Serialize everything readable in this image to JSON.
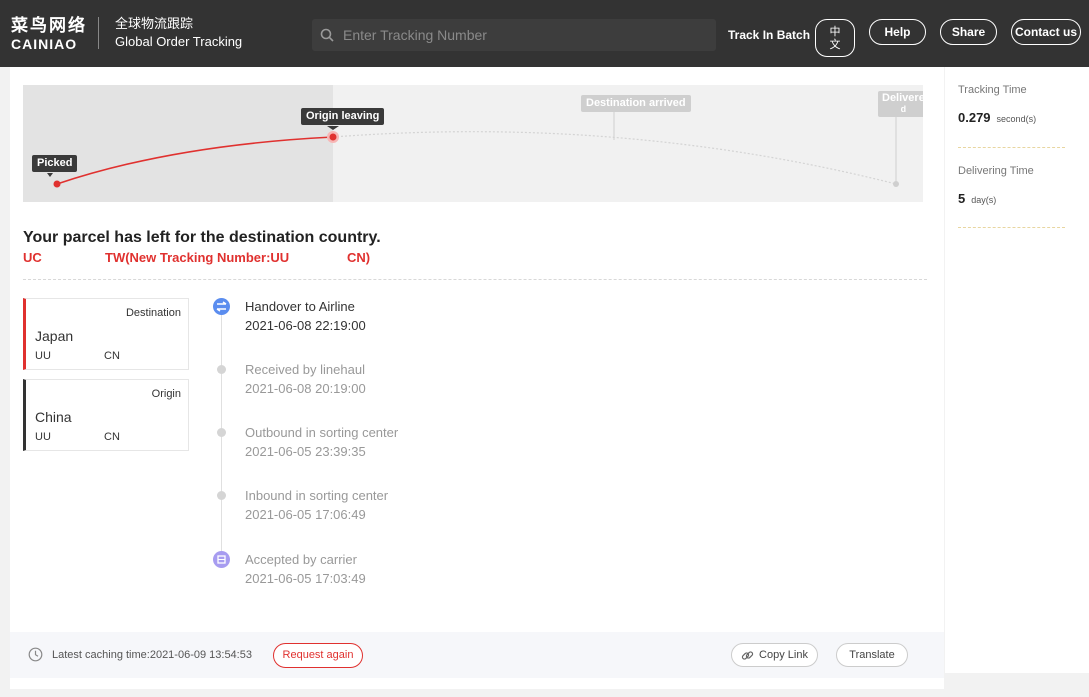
{
  "header": {
    "logo_cn": "菜鸟网络",
    "logo_en": "CAINIAO",
    "title_cn": "全球物流跟踪",
    "title_en": "Global Order Tracking",
    "search_placeholder": "Enter Tracking Number",
    "batch_label": "Track In Batch",
    "lang_line1": "中",
    "lang_line2": "文",
    "help_label": "Help",
    "share_label": "Share",
    "contact_label": "Contact us"
  },
  "map": {
    "stages": [
      "Picked",
      "Origin leaving",
      "Destination arrived",
      "Delivered"
    ],
    "delivered_visible": "Delivere",
    "delivered_wrap": "d",
    "progress_color": "#e0312f"
  },
  "status": {
    "headline": "Your parcel has left for the destination country.",
    "tracking_part1": "UC",
    "tracking_part2": "TW(New Tracking Number:UU",
    "tracking_part3": "CN)"
  },
  "route": {
    "destination": {
      "role": "Destination",
      "country": "Japan",
      "code_left": "UU",
      "code_right": "CN"
    },
    "origin": {
      "role": "Origin",
      "country": "China",
      "code_left": "UU",
      "code_right": "CN"
    }
  },
  "events": [
    {
      "title": "Handover to Airline",
      "time": "2021-06-08 22:19:00"
    },
    {
      "title": "Received by linehaul",
      "time": "2021-06-08 20:19:00"
    },
    {
      "title": "Outbound in sorting center",
      "time": "2021-06-05 23:39:35"
    },
    {
      "title": "Inbound in sorting center",
      "time": "2021-06-05 17:06:49"
    },
    {
      "title": "Accepted by carrier",
      "time": "2021-06-05 17:03:49"
    }
  ],
  "footer": {
    "cache_text": "Latest caching time:2021-06-09 13:54:53",
    "request_label": "Request again",
    "copy_label": "Copy Link",
    "translate_label": "Translate"
  },
  "stats": {
    "tracking_time_label": "Tracking Time",
    "tracking_time_value": "0.279",
    "tracking_time_unit": "second(s)",
    "delivering_time_label": "Delivering Time",
    "delivering_time_value": "5",
    "delivering_time_unit": "day(s)"
  },
  "colors": {
    "accent": "#e0312f",
    "header_bg": "#333333",
    "plane_icon": "#5b8def",
    "carrier_icon": "#a79cf0"
  }
}
